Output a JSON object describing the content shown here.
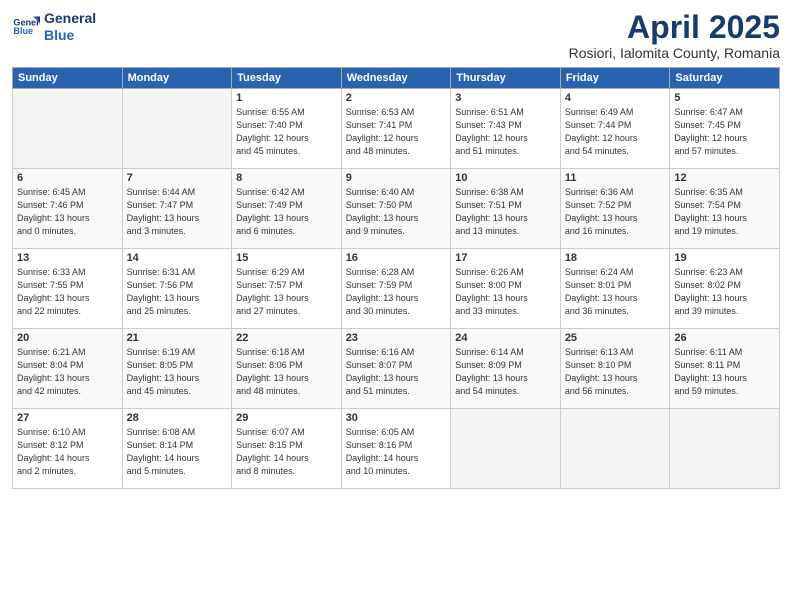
{
  "header": {
    "logo_line1": "General",
    "logo_line2": "Blue",
    "month": "April 2025",
    "location": "Rosiori, Ialomita County, Romania"
  },
  "weekdays": [
    "Sunday",
    "Monday",
    "Tuesday",
    "Wednesday",
    "Thursday",
    "Friday",
    "Saturday"
  ],
  "weeks": [
    [
      {
        "day": "",
        "info": ""
      },
      {
        "day": "",
        "info": ""
      },
      {
        "day": "1",
        "info": "Sunrise: 6:55 AM\nSunset: 7:40 PM\nDaylight: 12 hours\nand 45 minutes."
      },
      {
        "day": "2",
        "info": "Sunrise: 6:53 AM\nSunset: 7:41 PM\nDaylight: 12 hours\nand 48 minutes."
      },
      {
        "day": "3",
        "info": "Sunrise: 6:51 AM\nSunset: 7:43 PM\nDaylight: 12 hours\nand 51 minutes."
      },
      {
        "day": "4",
        "info": "Sunrise: 6:49 AM\nSunset: 7:44 PM\nDaylight: 12 hours\nand 54 minutes."
      },
      {
        "day": "5",
        "info": "Sunrise: 6:47 AM\nSunset: 7:45 PM\nDaylight: 12 hours\nand 57 minutes."
      }
    ],
    [
      {
        "day": "6",
        "info": "Sunrise: 6:45 AM\nSunset: 7:46 PM\nDaylight: 13 hours\nand 0 minutes."
      },
      {
        "day": "7",
        "info": "Sunrise: 6:44 AM\nSunset: 7:47 PM\nDaylight: 13 hours\nand 3 minutes."
      },
      {
        "day": "8",
        "info": "Sunrise: 6:42 AM\nSunset: 7:49 PM\nDaylight: 13 hours\nand 6 minutes."
      },
      {
        "day": "9",
        "info": "Sunrise: 6:40 AM\nSunset: 7:50 PM\nDaylight: 13 hours\nand 9 minutes."
      },
      {
        "day": "10",
        "info": "Sunrise: 6:38 AM\nSunset: 7:51 PM\nDaylight: 13 hours\nand 13 minutes."
      },
      {
        "day": "11",
        "info": "Sunrise: 6:36 AM\nSunset: 7:52 PM\nDaylight: 13 hours\nand 16 minutes."
      },
      {
        "day": "12",
        "info": "Sunrise: 6:35 AM\nSunset: 7:54 PM\nDaylight: 13 hours\nand 19 minutes."
      }
    ],
    [
      {
        "day": "13",
        "info": "Sunrise: 6:33 AM\nSunset: 7:55 PM\nDaylight: 13 hours\nand 22 minutes."
      },
      {
        "day": "14",
        "info": "Sunrise: 6:31 AM\nSunset: 7:56 PM\nDaylight: 13 hours\nand 25 minutes."
      },
      {
        "day": "15",
        "info": "Sunrise: 6:29 AM\nSunset: 7:57 PM\nDaylight: 13 hours\nand 27 minutes."
      },
      {
        "day": "16",
        "info": "Sunrise: 6:28 AM\nSunset: 7:59 PM\nDaylight: 13 hours\nand 30 minutes."
      },
      {
        "day": "17",
        "info": "Sunrise: 6:26 AM\nSunset: 8:00 PM\nDaylight: 13 hours\nand 33 minutes."
      },
      {
        "day": "18",
        "info": "Sunrise: 6:24 AM\nSunset: 8:01 PM\nDaylight: 13 hours\nand 36 minutes."
      },
      {
        "day": "19",
        "info": "Sunrise: 6:23 AM\nSunset: 8:02 PM\nDaylight: 13 hours\nand 39 minutes."
      }
    ],
    [
      {
        "day": "20",
        "info": "Sunrise: 6:21 AM\nSunset: 8:04 PM\nDaylight: 13 hours\nand 42 minutes."
      },
      {
        "day": "21",
        "info": "Sunrise: 6:19 AM\nSunset: 8:05 PM\nDaylight: 13 hours\nand 45 minutes."
      },
      {
        "day": "22",
        "info": "Sunrise: 6:18 AM\nSunset: 8:06 PM\nDaylight: 13 hours\nand 48 minutes."
      },
      {
        "day": "23",
        "info": "Sunrise: 6:16 AM\nSunset: 8:07 PM\nDaylight: 13 hours\nand 51 minutes."
      },
      {
        "day": "24",
        "info": "Sunrise: 6:14 AM\nSunset: 8:09 PM\nDaylight: 13 hours\nand 54 minutes."
      },
      {
        "day": "25",
        "info": "Sunrise: 6:13 AM\nSunset: 8:10 PM\nDaylight: 13 hours\nand 56 minutes."
      },
      {
        "day": "26",
        "info": "Sunrise: 6:11 AM\nSunset: 8:11 PM\nDaylight: 13 hours\nand 59 minutes."
      }
    ],
    [
      {
        "day": "27",
        "info": "Sunrise: 6:10 AM\nSunset: 8:12 PM\nDaylight: 14 hours\nand 2 minutes."
      },
      {
        "day": "28",
        "info": "Sunrise: 6:08 AM\nSunset: 8:14 PM\nDaylight: 14 hours\nand 5 minutes."
      },
      {
        "day": "29",
        "info": "Sunrise: 6:07 AM\nSunset: 8:15 PM\nDaylight: 14 hours\nand 8 minutes."
      },
      {
        "day": "30",
        "info": "Sunrise: 6:05 AM\nSunset: 8:16 PM\nDaylight: 14 hours\nand 10 minutes."
      },
      {
        "day": "",
        "info": ""
      },
      {
        "day": "",
        "info": ""
      },
      {
        "day": "",
        "info": ""
      }
    ]
  ]
}
